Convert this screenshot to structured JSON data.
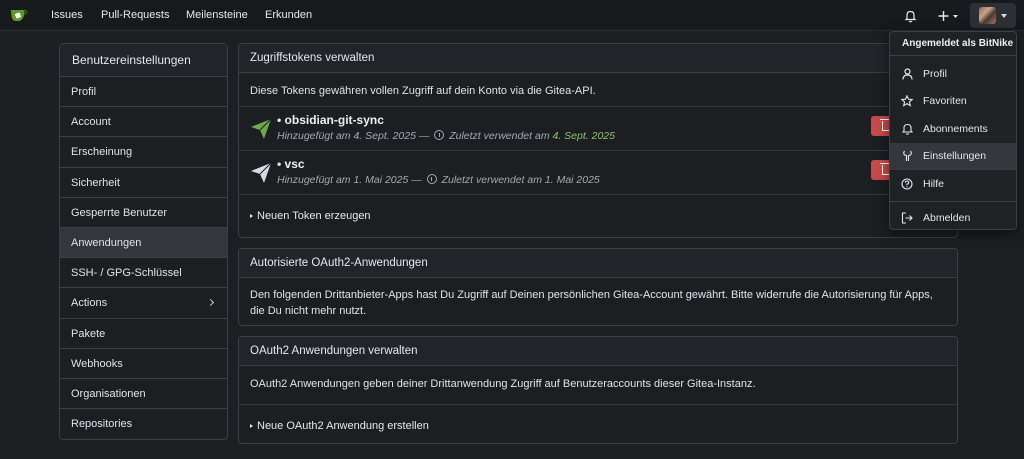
{
  "nav": {
    "links": [
      "Issues",
      "Pull-Requests",
      "Meilensteine",
      "Erkunden"
    ]
  },
  "sidebar": {
    "title": "Benutzereinstellungen",
    "items": [
      {
        "label": "Profil"
      },
      {
        "label": "Account"
      },
      {
        "label": "Erscheinung"
      },
      {
        "label": "Sicherheit"
      },
      {
        "label": "Gesperrte Benutzer"
      },
      {
        "label": "Anwendungen"
      },
      {
        "label": "SSH- / GPG-Schlüssel"
      },
      {
        "label": "Actions"
      },
      {
        "label": "Pakete"
      },
      {
        "label": "Webhooks"
      },
      {
        "label": "Organisationen"
      },
      {
        "label": "Repositories"
      }
    ]
  },
  "tokens": {
    "title": "Zugriffstokens verwalten",
    "description": "Diese Tokens gewähren vollen Zugriff auf dein Konto via die Gitea-API.",
    "items": [
      {
        "name": "obsidian-git-sync",
        "added": "Hinzugefügt am 4. Sept. 2025 —",
        "last_used_prefix": "Zuletzt verwendet am",
        "last_used_date": "4. Sept. 2025",
        "icon_color": "#6ea84d"
      },
      {
        "name": "vsc",
        "added": "Hinzugefügt am 1. Mai 2025 —",
        "last_used_prefix": "Zuletzt verwendet am",
        "last_used_date": "1. Mai 2025",
        "icon_color": "#d6dbe1"
      }
    ],
    "new_token": "Neuen Token erzeugen"
  },
  "oauth_authorized": {
    "title": "Autorisierte OAuth2-Anwendungen",
    "text": "Den folgenden Drittanbieter-Apps hast Du Zugriff auf Deinen persönlichen Gitea-Account gewährt. Bitte widerrufe die Autorisierung für Apps, die Du nicht mehr nutzt."
  },
  "oauth_manage": {
    "title": "OAuth2 Anwendungen verwalten",
    "text": "OAuth2 Anwendungen geben deiner Drittanwendung Zugriff auf Benutzeraccounts dieser Gitea-Instanz.",
    "create": "Neue OAuth2 Anwendung erstellen"
  },
  "dropdown": {
    "header": "Angemeldet als BitNike",
    "items": [
      {
        "label": "Profil",
        "icon": "person-icon"
      },
      {
        "label": "Favoriten",
        "icon": "star-icon"
      },
      {
        "label": "Abonnements",
        "icon": "bell-icon"
      },
      {
        "label": "Einstellungen",
        "icon": "tools-icon"
      },
      {
        "label": "Hilfe",
        "icon": "question-icon"
      },
      {
        "label": "Abmelden",
        "icon": "sign-out-icon"
      }
    ]
  },
  "colors": {
    "accent_green": "#8cc265",
    "danger": "#c64a48",
    "logo_green": "#609926"
  }
}
